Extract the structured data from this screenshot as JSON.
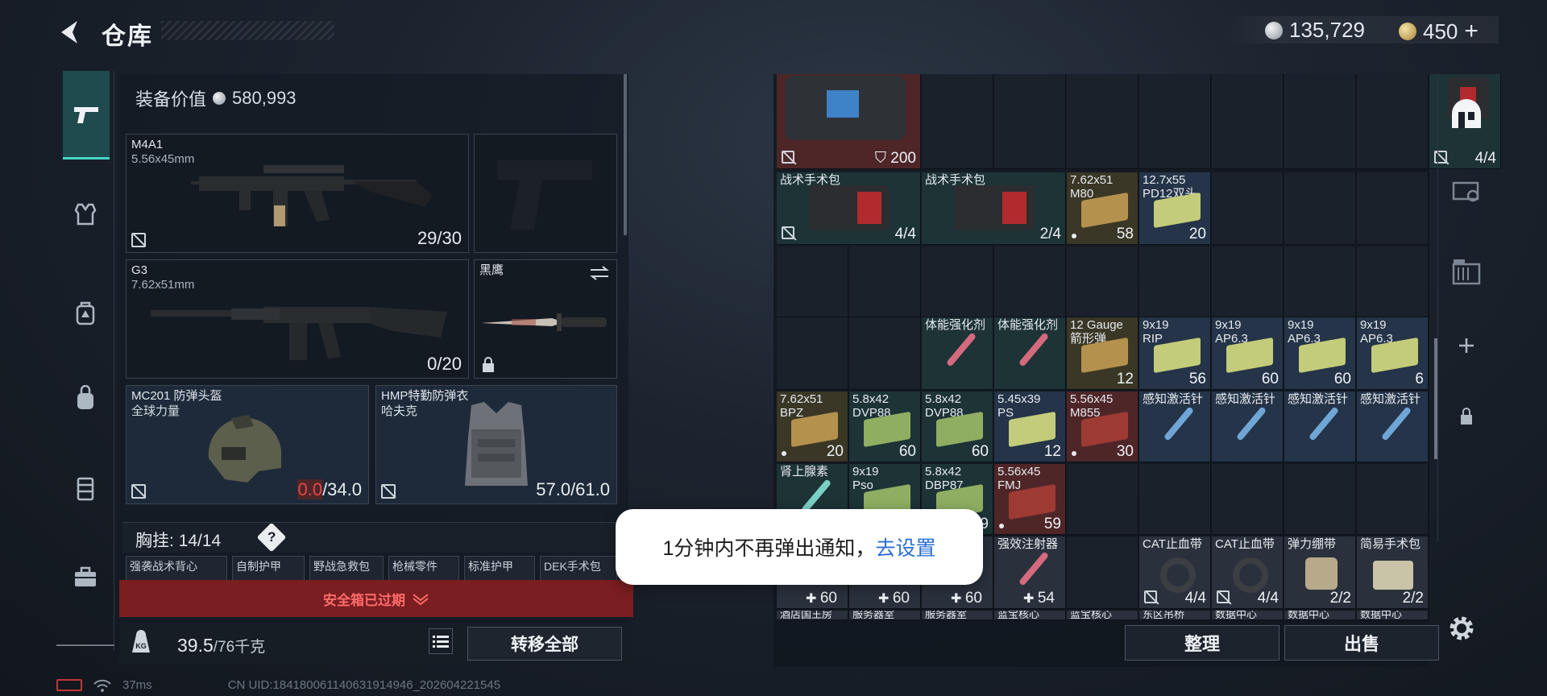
{
  "header": {
    "title": "仓库",
    "currency_1": "135,729",
    "currency_2": "450",
    "currency_2_add": "+"
  },
  "nav": {
    "items": [
      "weapon-icon",
      "armor-icon",
      "backpack-icon",
      "bag-icon",
      "vest-icon",
      "toolbox-icon"
    ],
    "active": "weapon-icon"
  },
  "loadout": {
    "equipment_value_label": "装备价值",
    "equipment_value": "580,993",
    "primary": {
      "name": "M4A1",
      "caliber": "5.56x45mm",
      "count": "29/30"
    },
    "secondary": {
      "name": "G3",
      "caliber": "7.62x51mm",
      "count": "0/20"
    },
    "melee": {
      "name": "黑鹰"
    },
    "helmet": {
      "name": "MC201 防弹头盔",
      "sub": "全球力量",
      "durability_current": "0.0",
      "durability_max": "/34.0"
    },
    "armor": {
      "name": "HMP特勤防弹衣",
      "sub": "哈夫克",
      "durability": "57.0/61.0"
    },
    "vest_label": "胸挂:",
    "vest_count": "14/14",
    "vest_help": "?",
    "vest_items": [
      "强袭战术背心",
      "自制护甲",
      "野战急救包",
      "枪械零件",
      "标准护甲",
      "DEK手术包"
    ],
    "safebox_expired": "安全箱已过期",
    "weight": "39.5",
    "weight_max": "/76千克",
    "weight_icon_text": "KG",
    "transfer_all": "转移全部"
  },
  "storage": {
    "rows": [
      [
        {
          "c": "red",
          "ct": "200",
          "shield": true,
          "nx": true,
          "span": 2
        },
        {
          "c": "empty"
        },
        {
          "c": "empty"
        },
        {
          "c": "empty"
        },
        {
          "c": "empty"
        },
        {
          "c": "empty"
        },
        {
          "c": "empty"
        },
        {
          "c": "empty"
        },
        {
          "c": "teal",
          "ct": "4/4",
          "nx": true
        }
      ],
      [
        {
          "c": "teal",
          "nm": "战术手术包",
          "ct": "4/4",
          "nx": true,
          "span": 2
        },
        {
          "c": "teal",
          "nm": "战术手术包",
          "ct": "2/4",
          "span": 2
        },
        {
          "c": "yellow",
          "nm": "7.62x51\nM80",
          "ct": "58",
          "dot": true
        },
        {
          "c": "blue",
          "nm": "12.7x55\nPD12双头",
          "ct": "20"
        },
        {
          "c": "empty"
        },
        {
          "c": "empty"
        },
        {
          "c": "empty"
        }
      ],
      [
        {
          "c": "empty"
        },
        {
          "c": "empty"
        },
        {
          "c": "empty"
        },
        {
          "c": "empty"
        },
        {
          "c": "empty"
        },
        {
          "c": "empty"
        },
        {
          "c": "empty"
        },
        {
          "c": "empty"
        },
        {
          "c": "empty"
        }
      ],
      [
        {
          "c": "empty"
        },
        {
          "c": "empty"
        },
        {
          "c": "teal",
          "nm": "体能强化剂"
        },
        {
          "c": "teal",
          "nm": "体能强化剂"
        },
        {
          "c": "yellow",
          "nm": "12 Gauge\n箭形弹",
          "ct": "12"
        },
        {
          "c": "blue",
          "nm": "9x19\nRIP",
          "ct": "56"
        },
        {
          "c": "blue",
          "nm": "9x19\nAP6.3",
          "ct": "60"
        },
        {
          "c": "blue",
          "nm": "9x19\nAP6.3",
          "ct": "60"
        },
        {
          "c": "blue",
          "nm": "9x19\nAP6.3",
          "ct": "6"
        }
      ],
      [
        {
          "c": "yellow",
          "nm": "7.62x51\nBPZ",
          "ct": "20",
          "dot": true
        },
        {
          "c": "teal",
          "nm": "5.8x42\nDVP88",
          "ct": "60"
        },
        {
          "c": "teal",
          "nm": "5.8x42\nDVP88",
          "ct": "60"
        },
        {
          "c": "blue",
          "nm": "5.45x39\nPS",
          "ct": "12"
        },
        {
          "c": "red",
          "nm": "5.56x45\nM855",
          "ct": "30",
          "dot": true
        },
        {
          "c": "blue",
          "nm": "感知激活针"
        },
        {
          "c": "blue",
          "nm": "感知激活针"
        },
        {
          "c": "blue",
          "nm": "感知激活针"
        },
        {
          "c": "blue",
          "nm": "感知激活针"
        }
      ],
      [
        {
          "c": "teal",
          "nm": "肾上腺素"
        },
        {
          "c": "teal",
          "nm": "9x19\nPso"
        },
        {
          "c": "teal",
          "nm": "5.8x42\nDBP87",
          "ct": "9"
        },
        {
          "c": "red",
          "nm": "5.56x45\nFMJ",
          "ct": "59",
          "dot": true
        },
        {
          "c": "empty"
        },
        {
          "c": "empty"
        },
        {
          "c": "empty"
        },
        {
          "c": "empty"
        },
        {
          "c": "empty"
        }
      ],
      [
        {
          "c": "gray",
          "plus": "60"
        },
        {
          "c": "gray",
          "plus": "60"
        },
        {
          "c": "gray",
          "plus": "60"
        },
        {
          "c": "gray",
          "nm": "强效注射器",
          "plus": "54"
        },
        {
          "c": "empty"
        },
        {
          "c": "gray",
          "nm": "CAT止血带",
          "ct": "4/4",
          "nx": true
        },
        {
          "c": "gray",
          "nm": "CAT止血带",
          "ct": "4/4",
          "nx": true
        },
        {
          "c": "gray",
          "nm": "弹力绷带",
          "ct": "2/2"
        },
        {
          "c": "gray",
          "nm": "简易手术包",
          "ct": "2/2"
        }
      ]
    ],
    "partial_row": [
      "酒店国王房",
      "服务器室",
      "服务器室",
      "蓝宝核心",
      "蓝宝核心",
      "东区吊桥",
      "数据中心",
      "数据中心",
      "数据中心"
    ],
    "sort_label": "整理",
    "sell_label": "出售"
  },
  "notification": {
    "text": "1分钟内不再弹出通知，",
    "link": "去设置"
  },
  "status": {
    "ping": "37ms",
    "uid": "CN UID:184180061140631914946_202604221545"
  },
  "colors": {
    "accent_teal": "#44d6c6",
    "danger_red": "#e2484a",
    "expired_bg": "#7a1e21",
    "link_blue": "#2a6fd6"
  }
}
